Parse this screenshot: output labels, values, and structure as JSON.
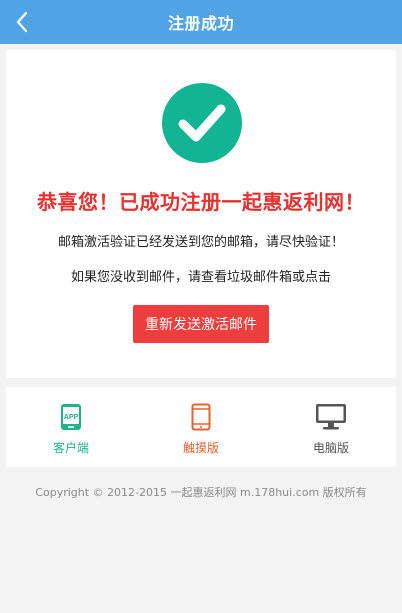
{
  "header": {
    "title": "注册成功"
  },
  "main": {
    "congrats": "恭喜您！已成功注册一起惠返利网！",
    "line1": "邮箱激活验证已经发送到您的邮箱，请尽快验证！",
    "line2": "如果您没收到邮件，请查看垃圾邮件箱或点击",
    "resend_label": "重新发送激活邮件",
    "check_color": "#13b493"
  },
  "versions": {
    "app": {
      "label": "客户端",
      "badge": "APP",
      "color": "#1fb28c",
      "icon": "mobile-app-icon"
    },
    "touch": {
      "label": "触摸版",
      "color": "#e8622f",
      "icon": "phone-icon"
    },
    "pc": {
      "label": "电脑版",
      "color": "#555555",
      "icon": "monitor-icon"
    }
  },
  "footer": {
    "copyright": "Copyright © 2012-2015 一起惠返利网 m.178hui.com 版权所有"
  }
}
